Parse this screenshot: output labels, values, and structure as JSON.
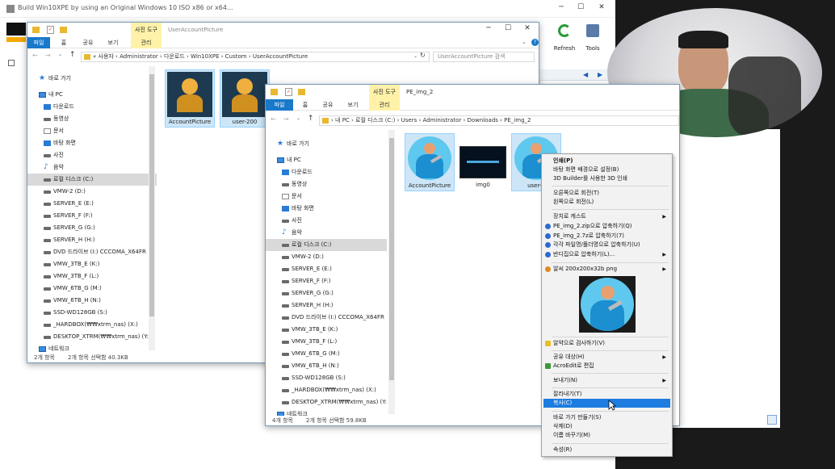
{
  "bg_window": {
    "title": "Build Win10XPE by using an Original Windows 10 ISO x86 or x64...",
    "toolbar": {
      "refresh_label": "Refresh",
      "tools_label": "Tools"
    },
    "controls": {
      "min": "─",
      "max": "☐",
      "close": "✕"
    }
  },
  "win1": {
    "quick_access_icons": [
      "folder-icon",
      "check-icon",
      "folder-icon"
    ],
    "context_tab": "사진 도구",
    "title": "UserAccountPicture",
    "tabs": [
      "파일",
      "홈",
      "공유",
      "보기",
      "관리"
    ],
    "address": "« 사용자 › Administrator › 다운로드 › Win10XPE › Custom › UserAccountPicture",
    "search_placeholder": "UserAccountPicture 검색",
    "nav": [
      "바로 가기",
      "내 PC",
      "다운로드",
      "동영상",
      "문서",
      "바탕 화면",
      "사진",
      "음악",
      "로컬 디스크 (C:)",
      "VMW-2 (D:)",
      "SERVER_E (E:)",
      "SERVER_F (F:)",
      "SERVER_G (G:)",
      "SERVER_H (H:)",
      "DVD 드라이브 (I:) CCCOMA_X64FR",
      "VMW_3TB_E (K:)",
      "VMW_3TB_F (L:)",
      "VMW_6TB_G (M:)",
      "VMW_6TB_H (N:)",
      "SSD-WD128GB (S:)",
      "_HARDBOX(₩₩xtrm_nas) (X:)",
      "DESKTOP_XTRM(₩₩xtrm_nas) (Y:)",
      "네트워크"
    ],
    "files": [
      "AccountPicture",
      "user-200"
    ],
    "status_count": "2개 항목",
    "status_selected": "2개 항목 선택함 40.3KB"
  },
  "win2": {
    "context_tab": "사진 도구",
    "title": "PE_img_2",
    "tabs": [
      "파일",
      "홈",
      "공유",
      "보기",
      "관리"
    ],
    "address": "› 내 PC › 로컬 디스크 (C:) › Users › Administrator › Downloads › PE_img_2",
    "nav": [
      "바로 가기",
      "내 PC",
      "다운로드",
      "동영상",
      "문서",
      "바탕 화면",
      "사진",
      "음악",
      "로컬 디스크 (C:)",
      "VMW-2 (D:)",
      "SERVER_E (E:)",
      "SERVER_F (F:)",
      "SERVER_G (G:)",
      "SERVER_H (H:)",
      "DVD 드라이브 (I:) CCCOMA_X64FR",
      "VMW_3TB_E (K:)",
      "VMW_3TB_F (L:)",
      "VMW_6TB_G (M:)",
      "VMW_6TB_H (N:)",
      "SSD-WD128GB (S:)",
      "_HARDBOX(₩₩xtrm_nas) (X:)",
      "DESKTOP_XTRM(₩₩xtrm_nas) (Y:)",
      "네트워크"
    ],
    "files": [
      "AccountPicture",
      "img0",
      "user-2"
    ],
    "status_count": "4개 항목",
    "status_selected": "2개 항목 선택함 59.8KB"
  },
  "context_menu": {
    "items": [
      {
        "label": "인쇄(P)",
        "bold": true
      },
      {
        "label": "바탕 화면 배경으로 설정(B)"
      },
      {
        "label": "3D Builder를 사용한 3D 인쇄"
      },
      {
        "sep": true
      },
      {
        "label": "오른쪽으로 회전(T)"
      },
      {
        "label": "왼쪽으로 회전(L)"
      },
      {
        "sep": true
      },
      {
        "label": "장치로 캐스트",
        "arrow": "▶"
      },
      {
        "label": "PE_img_2.zip으로 압축하기(Q)",
        "icon": "bandizip-icon"
      },
      {
        "label": "PE_img_2.7z로 압축하기(7)",
        "icon": "bandizip-icon"
      },
      {
        "label": "각각 파일명/폴더명으로 압축하기(U)",
        "icon": "bandizip-icon"
      },
      {
        "label": "반디집으로 압축하기(L)...",
        "icon": "bandizip-icon",
        "arrow": "▶"
      },
      {
        "sep": true
      },
      {
        "label": "알씨 200x200x32b png",
        "icon": "alsee-icon",
        "arrow": "▶"
      },
      {
        "preview": true
      },
      {
        "sep": true
      },
      {
        "label": "알약으로 검사하기(V)",
        "icon": "alyac-icon"
      },
      {
        "sep": true
      },
      {
        "label": "공유 대상(H)",
        "arrow": "▶"
      },
      {
        "label": "AcroEdit로 편집",
        "icon": "acroedit-icon"
      },
      {
        "sep": true
      },
      {
        "label": "보내기(N)",
        "arrow": "▶"
      },
      {
        "sep": true
      },
      {
        "label": "잘라내기(T)"
      },
      {
        "label": "복사(C)",
        "highlight": true
      },
      {
        "sep": true
      },
      {
        "label": "바로 가기 만들기(S)"
      },
      {
        "label": "삭제(D)"
      },
      {
        "label": "이름 바꾸기(M)"
      },
      {
        "sep": true
      },
      {
        "label": "속성(R)"
      }
    ]
  },
  "colors": {
    "accent": "#1979ca",
    "highlight": "#1c7ce0",
    "context_tab": "#fff2a8",
    "avatar": "#5fc8ee"
  }
}
